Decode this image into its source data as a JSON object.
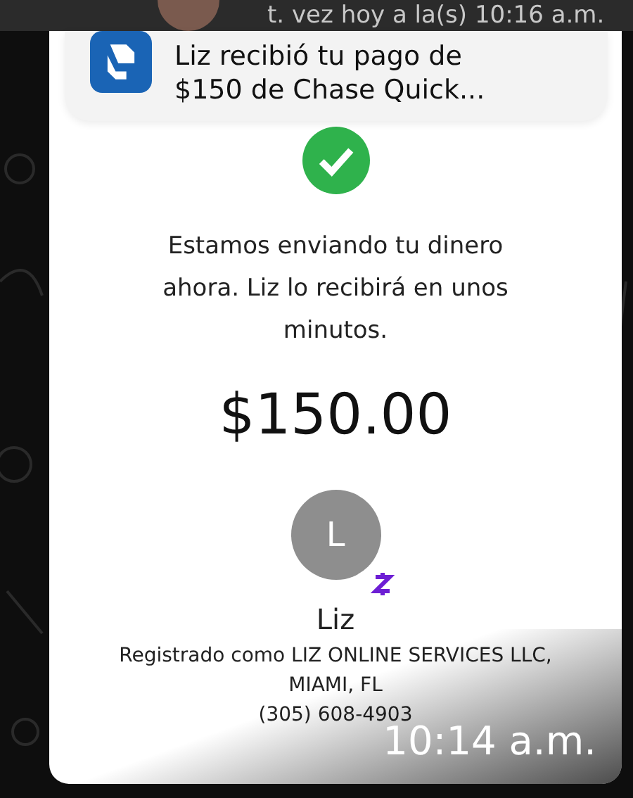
{
  "chat_header": {
    "status": "t. vez hoy a la(s) 10:16 a.m."
  },
  "notification": {
    "lines": [
      "Liz recibió tu pago de",
      "$150 de Chase Quick..."
    ]
  },
  "payment": {
    "message": "Estamos enviando tu dinero ahora. Liz lo recibirá en unos minutos.",
    "amount": "$150.00",
    "recipient": {
      "initial": "L",
      "name": "Liz",
      "registered": "Registrado como LIZ ONLINE SERVICES LLC, MIAMI, FL",
      "phone": "(305) 608-4903"
    }
  },
  "timestamp": "10:14 a.m."
}
